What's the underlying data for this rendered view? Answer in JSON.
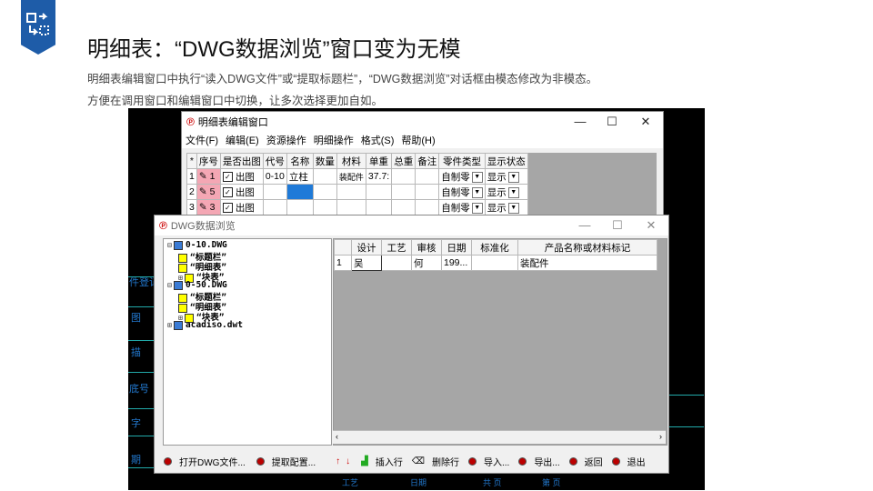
{
  "header": {
    "title": "明细表：“DWG数据浏览”窗口变为无模",
    "desc1": "明细表编辑窗口中执行“读入DWG文件”或“提取标题栏”，“DWG数据浏览”对话框由模态修改为非模态。",
    "desc2": "方便在调用窗口和编辑窗口中切换，让多次选择更加自如。"
  },
  "cad_bg": {
    "labels": [
      "件登记",
      "图",
      "描",
      "底号",
      "字",
      "期"
    ],
    "bottom": [
      "工艺",
      "日期",
      "共 页",
      "第 页"
    ]
  },
  "win1": {
    "title": "明细表编辑窗口",
    "menu": [
      "文件(F)",
      "编辑(E)",
      "资源操作",
      "明细操作",
      "格式(S)",
      "帮助(H)"
    ],
    "columns": [
      "*",
      "序号",
      "是否出图",
      "代号",
      "名称",
      "数量",
      "材料",
      "单重",
      "总重",
      "备注",
      "零件类型",
      "显示状态"
    ],
    "rows": [
      {
        "idx": "1",
        "seq": "1",
        "out": "出图",
        "code": "0-10",
        "name": "立柱",
        "qty": "",
        "mat": "装配件",
        "unit": "37.7:",
        "type": "自制零",
        "show": "显示"
      },
      {
        "idx": "2",
        "seq": "5",
        "out": "出图",
        "code": "",
        "name": "",
        "qty": "",
        "mat": "",
        "unit": "",
        "type": "自制零",
        "show": "显示"
      },
      {
        "idx": "3",
        "seq": "3",
        "out": "出图",
        "code": "",
        "name": "",
        "qty": "",
        "mat": "",
        "unit": "",
        "type": "自制零",
        "show": "显示"
      }
    ]
  },
  "win2": {
    "title": "DWG数据浏览",
    "tree": [
      "0-10.DWG",
      "“标题栏”",
      "“明细表”",
      "“块表”",
      "0-50.DWG",
      "“标题栏”",
      "“明细表”",
      "“块表”",
      "acadiso.dwt"
    ],
    "columns": [
      "设计",
      "工艺",
      "审核",
      "日期",
      "标准化",
      "产品名称或材料标记"
    ],
    "row": {
      "idx": "1",
      "design": "吴",
      "craft": "",
      "review": "何",
      "date": "199...",
      "std": "",
      "product": "装配件"
    },
    "buttons": [
      "打开DWG文件...",
      "提取配置...",
      "插入行",
      "删除行",
      "导入...",
      "导出...",
      "返回",
      "退出"
    ]
  }
}
